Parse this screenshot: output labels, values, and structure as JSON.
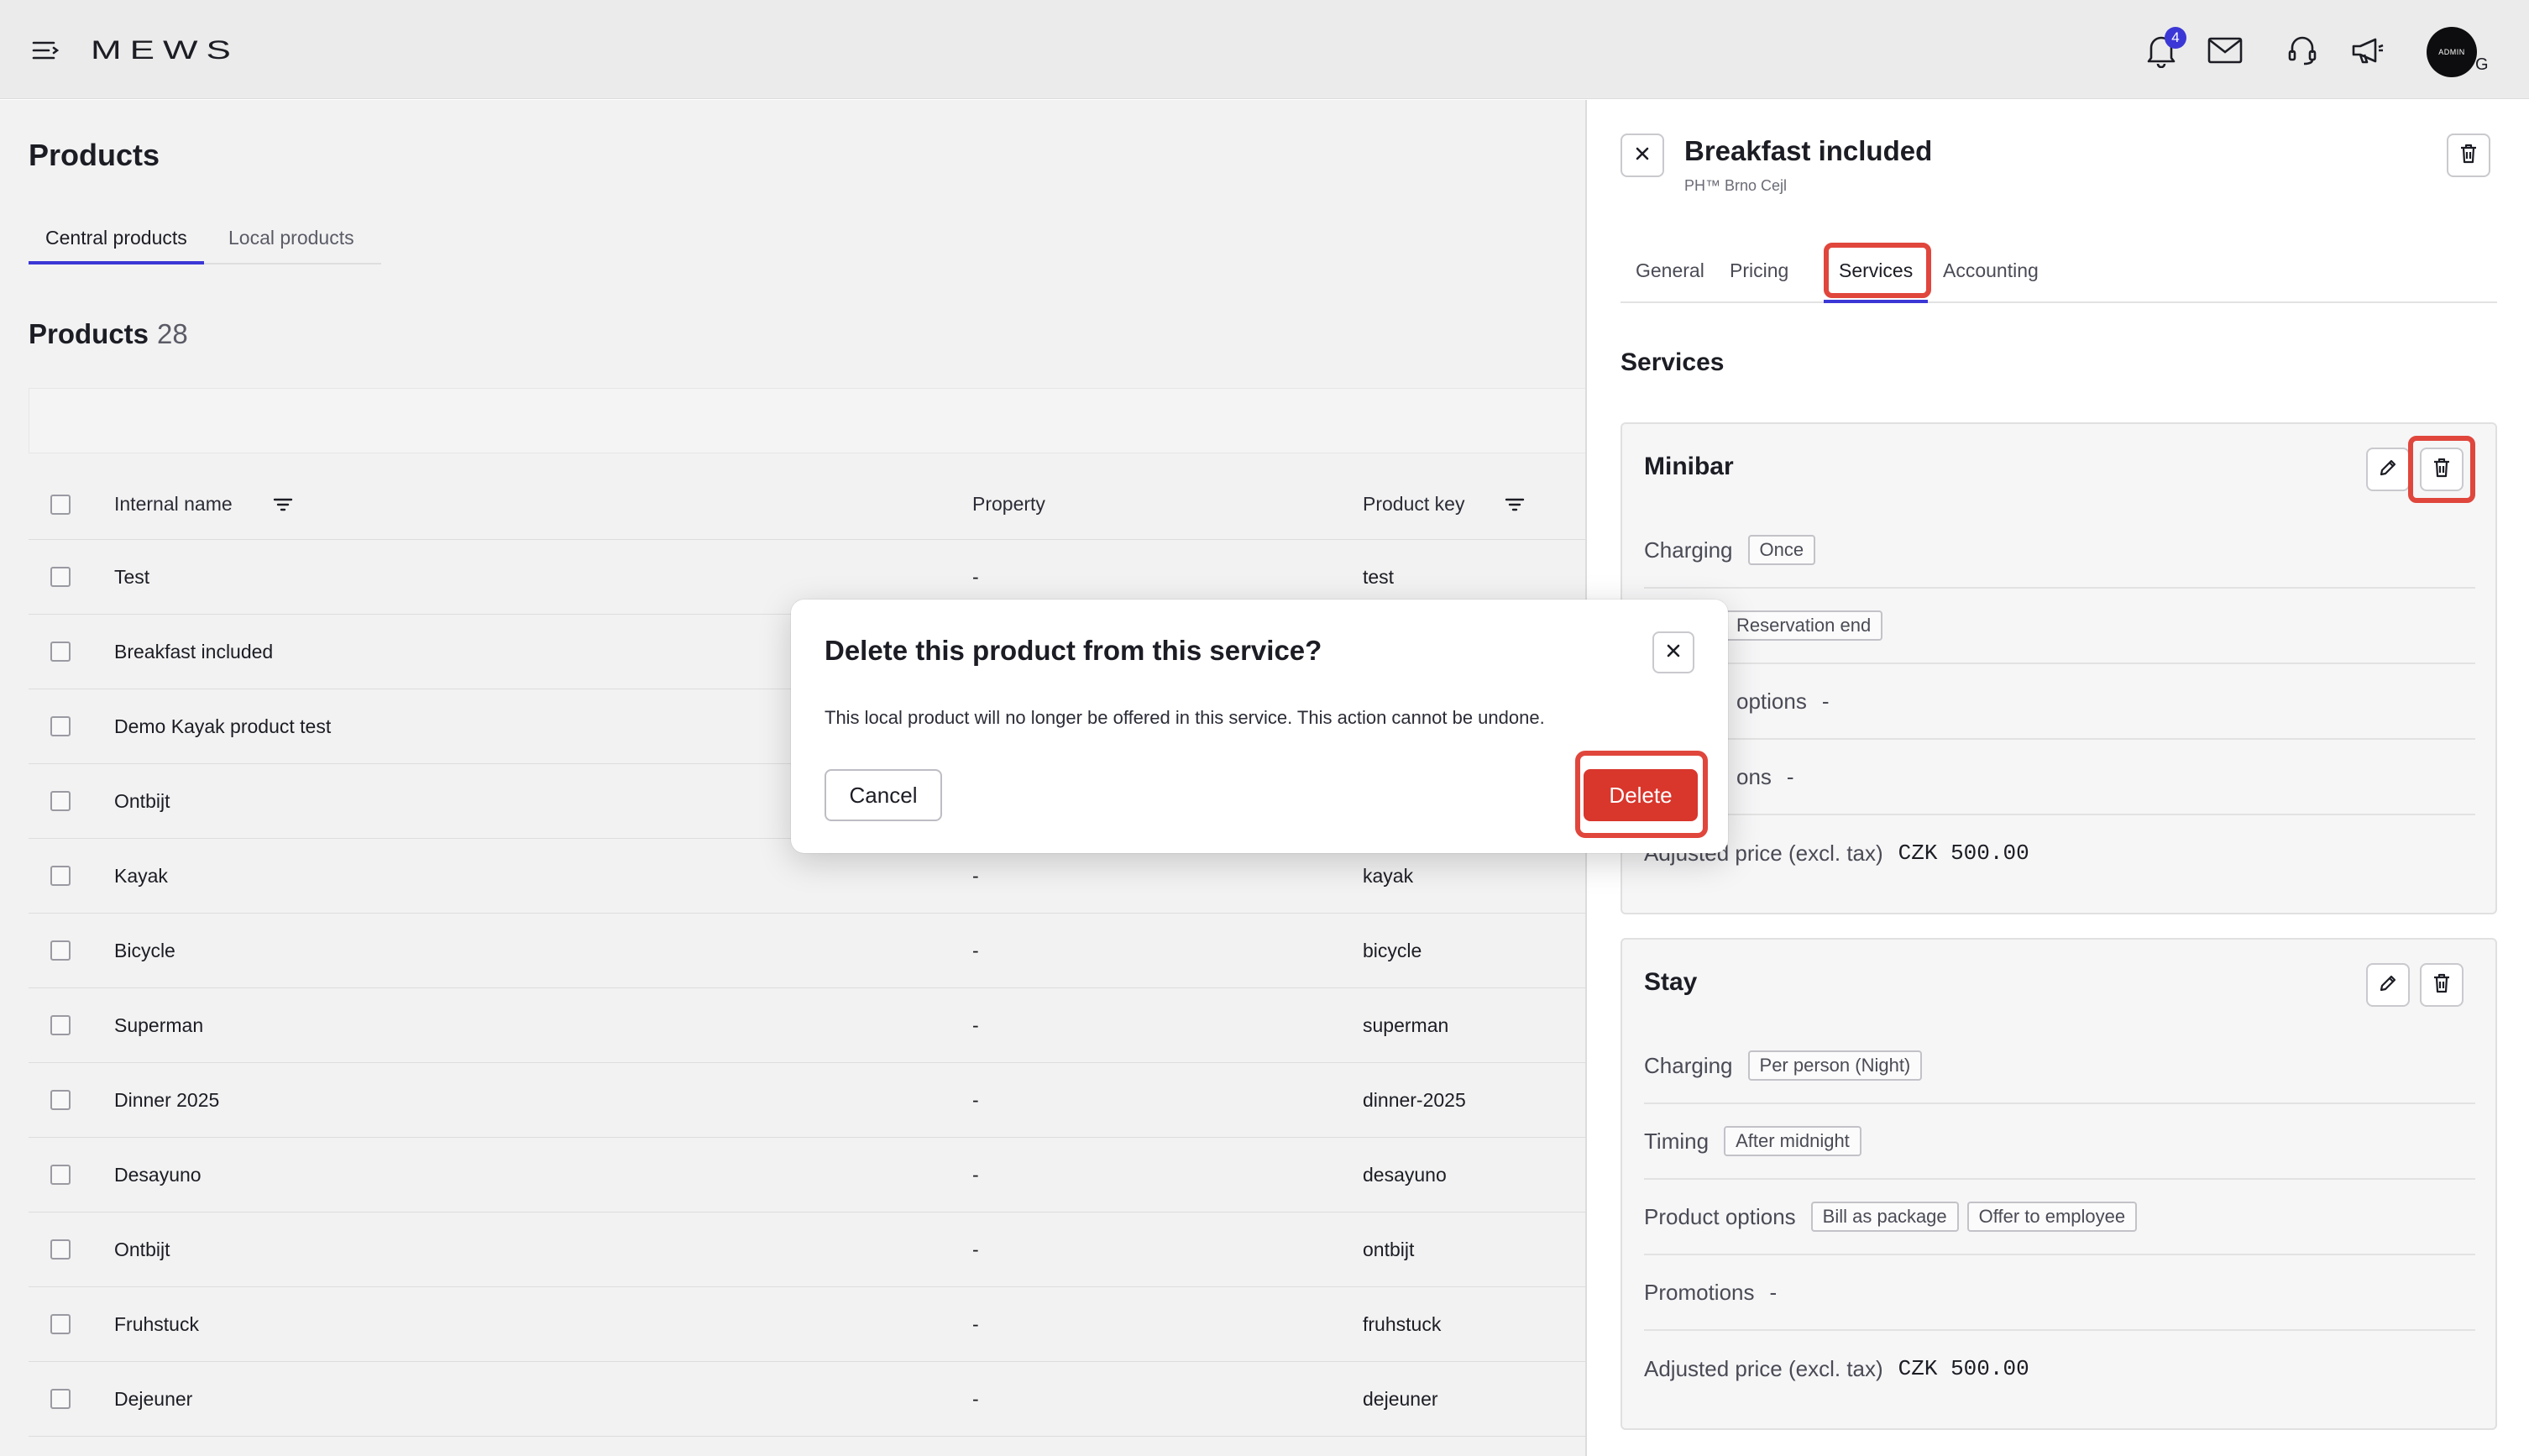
{
  "topbar": {
    "logo": "MEWS",
    "notification_count": "4",
    "avatar_text": "ADMIN",
    "avatar_letter": "G",
    "icons": [
      "menu-icon",
      "bell-icon",
      "mail-icon",
      "headset-icon",
      "megaphone-icon"
    ]
  },
  "main": {
    "title": "Products",
    "tabs": [
      {
        "label": "Central products",
        "active": true
      },
      {
        "label": "Local products",
        "active": false
      }
    ],
    "products_heading": "Products",
    "products_count": "28",
    "columns": {
      "internal_name": "Internal name",
      "property": "Property",
      "product_key": "Product key"
    },
    "rows": [
      {
        "name": "Test",
        "property": "-",
        "key": "test"
      },
      {
        "name": "Breakfast included",
        "property": "",
        "key": ""
      },
      {
        "name": "Demo Kayak product test",
        "property": "",
        "key": ""
      },
      {
        "name": "Ontbijt",
        "property": "",
        "key": ""
      },
      {
        "name": "Kayak",
        "property": "-",
        "key": "kayak"
      },
      {
        "name": "Bicycle",
        "property": "-",
        "key": "bicycle"
      },
      {
        "name": "Superman",
        "property": "-",
        "key": "superman"
      },
      {
        "name": "Dinner 2025",
        "property": "-",
        "key": "dinner-2025"
      },
      {
        "name": "Desayuno",
        "property": "-",
        "key": "desayuno"
      },
      {
        "name": "Ontbijt",
        "property": "-",
        "key": "ontbijt"
      },
      {
        "name": "Fruhstuck",
        "property": "-",
        "key": "fruhstuck"
      },
      {
        "name": "Dejeuner",
        "property": "-",
        "key": "dejeuner"
      }
    ]
  },
  "panel": {
    "title": "Breakfast included",
    "subtitle": "PH™ Brno Cejl",
    "tabs": [
      {
        "label": "General",
        "active": false
      },
      {
        "label": "Pricing",
        "active": false
      },
      {
        "label": "Services",
        "active": true
      },
      {
        "label": "Accounting",
        "active": false
      }
    ],
    "section_title": "Services",
    "services": [
      {
        "name": "Minibar",
        "rows": [
          {
            "label": "Charging",
            "tags": [
              "Once"
            ],
            "value": ""
          },
          {
            "label": "",
            "tags": [
              "Reservation end"
            ],
            "value": ""
          },
          {
            "label": "options",
            "tags": [],
            "value": "-"
          },
          {
            "label": "ons",
            "tags": [],
            "value": "-"
          },
          {
            "label": "Adjusted price (excl. tax)",
            "tags": [],
            "value": "CZK 500.00"
          }
        ]
      },
      {
        "name": "Stay",
        "rows": [
          {
            "label": "Charging",
            "tags": [
              "Per person (Night)"
            ],
            "value": ""
          },
          {
            "label": "Timing",
            "tags": [
              "After midnight"
            ],
            "value": ""
          },
          {
            "label": "Product options",
            "tags": [
              "Bill as package",
              "Offer to employee"
            ],
            "value": ""
          },
          {
            "label": "Promotions",
            "tags": [],
            "value": "-"
          },
          {
            "label": "Adjusted price (excl. tax)",
            "tags": [],
            "value": "CZK 500.00"
          }
        ]
      }
    ]
  },
  "dialog": {
    "title": "Delete this product from this service?",
    "body": "This local product will no longer be offered in this service. This action cannot be undone.",
    "cancel_label": "Cancel",
    "delete_label": "Delete"
  },
  "colors": {
    "accent": "#3b37d6",
    "danger": "#d9362c",
    "highlight": "#e0463c"
  }
}
